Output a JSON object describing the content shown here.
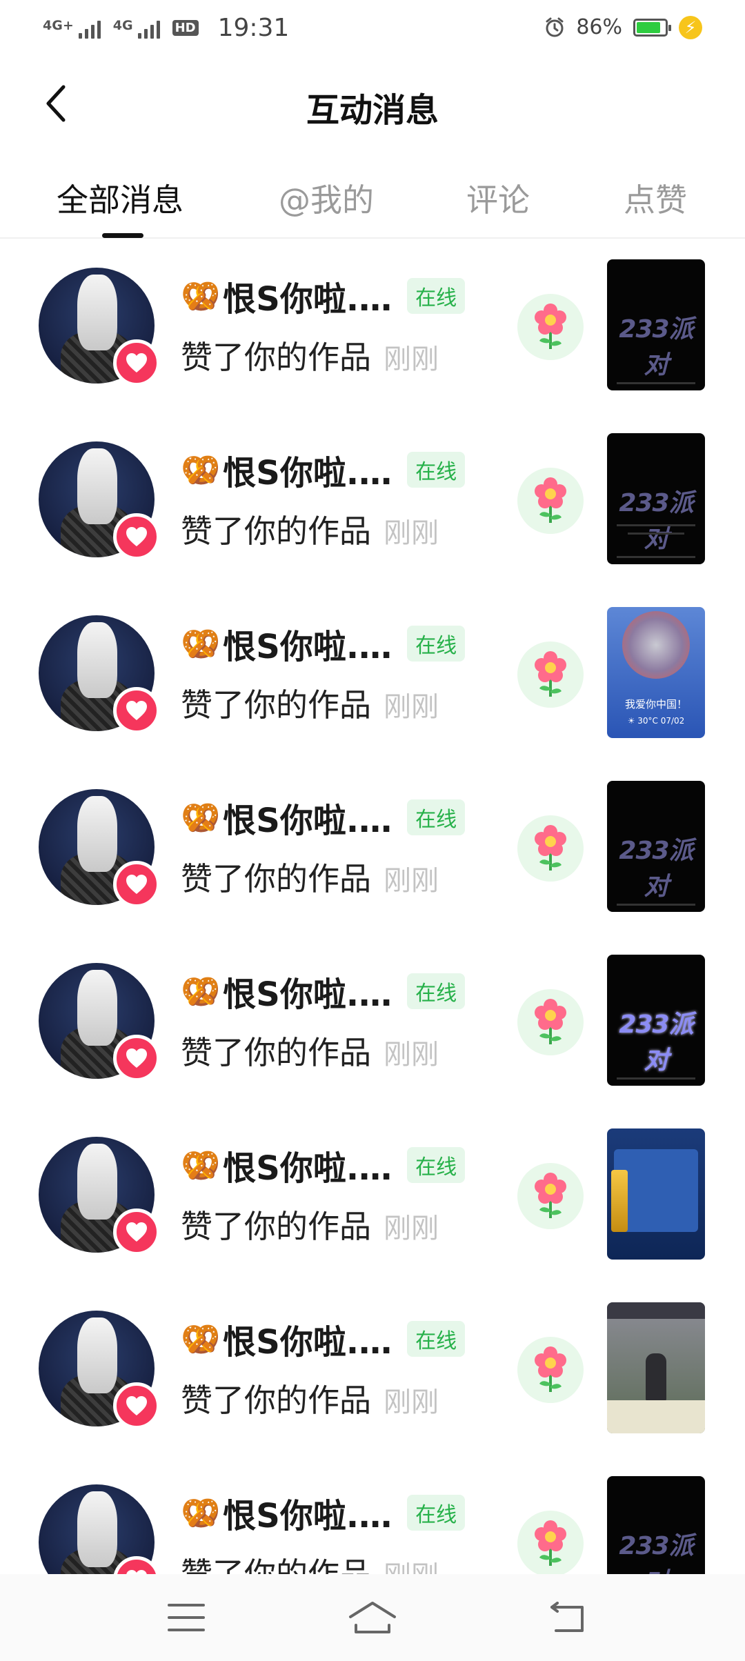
{
  "status_bar": {
    "signal1": "4G+",
    "signal2": "4G",
    "hd": "HD",
    "time": "19:31",
    "battery_text": "86%",
    "battery_level": 0.86
  },
  "header": {
    "title": "互动消息"
  },
  "tabs": [
    {
      "label": "全部消息",
      "active": true
    },
    {
      "label": "@我的",
      "active": false
    },
    {
      "label": "评论",
      "active": false
    },
    {
      "label": "点赞",
      "active": false
    }
  ],
  "messages": [
    {
      "username": "恨S你啦.…",
      "status": "在线",
      "action": "赞了你的作品",
      "time": "刚刚"
    },
    {
      "username": "恨S你啦.…",
      "status": "在线",
      "action": "赞了你的作品",
      "time": "刚刚"
    },
    {
      "username": "恨S你啦.…",
      "status": "在线",
      "action": "赞了你的作品",
      "time": "刚刚"
    },
    {
      "username": "恨S你啦.…",
      "status": "在线",
      "action": "赞了你的作品",
      "time": "刚刚"
    },
    {
      "username": "恨S你啦.…",
      "status": "在线",
      "action": "赞了你的作品",
      "time": "刚刚"
    },
    {
      "username": "恨S你啦.…",
      "status": "在线",
      "action": "赞了你的作品",
      "time": "刚刚"
    },
    {
      "username": "恨S你啦.…",
      "status": "在线",
      "action": "赞了你的作品",
      "time": "刚刚"
    },
    {
      "username": "恨S你啦.…",
      "status": "在线",
      "action": "赞了你的作品",
      "time": "刚刚"
    }
  ],
  "thumbnails": {
    "logo_text": "233派对",
    "china_caption": "我爱你中国！",
    "china_sub": "☀ 30°C  07/02"
  },
  "colors": {
    "online_green": "#27b14a",
    "heart_pink": "#f5365c",
    "battery_green": "#2ecc40"
  }
}
